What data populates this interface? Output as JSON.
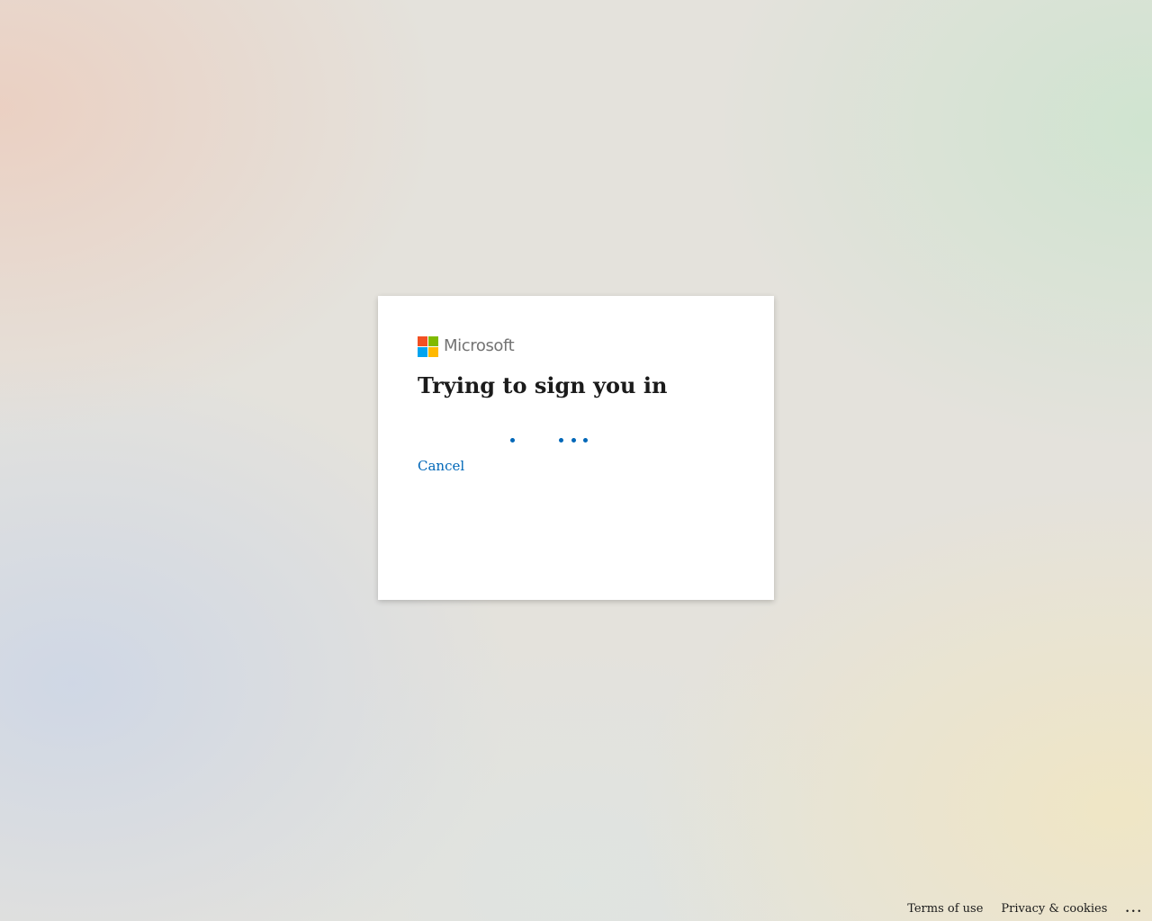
{
  "brand": {
    "name": "Microsoft",
    "logo_colors": [
      "#f25022",
      "#7fba00",
      "#00a4ef",
      "#ffb900"
    ]
  },
  "dialog": {
    "title": "Trying to sign you in",
    "cancel_label": "Cancel",
    "accent_color": "#0067b8"
  },
  "footer": {
    "terms_label": "Terms of use",
    "privacy_label": "Privacy & cookies",
    "more_label": "..."
  }
}
